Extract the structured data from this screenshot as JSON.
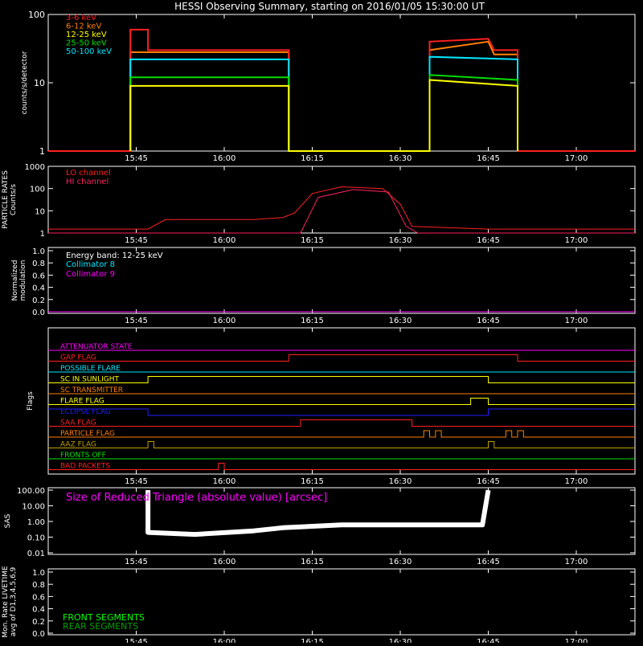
{
  "title": "HESSI Observing Summary, starting on 2016/01/05 15:30:00 UT",
  "time_ticks": [
    "15:45",
    "16:00",
    "16:15",
    "16:30",
    "16:45",
    "17:00"
  ],
  "colors": {
    "background": "#000000",
    "axes": "#ffffff",
    "e3_6": "#ff2020",
    "e6_12": "#ff8000",
    "e12_25": "#ffff00",
    "e25_50": "#00e000",
    "e50_100": "#00e8ff",
    "lo_channel": "#ff2020",
    "hi_channel": "#ff2060",
    "magenta": "#ff00ff",
    "front_segments": "#00ff00",
    "rear_segments": "#00a000"
  },
  "chart_data": [
    {
      "panel": "counts",
      "type": "line",
      "ylabel": "counts/s/detector",
      "yscale": "log",
      "ylim": [
        1,
        100
      ],
      "ytick_labels": [
        "1",
        "10",
        "100"
      ],
      "xlim": [
        "15:30",
        "17:10"
      ],
      "series": [
        {
          "name": "3-6 keV",
          "points": [
            [
              "15:30",
              1
            ],
            [
              "15:44",
              1
            ],
            [
              "15:44",
              60
            ],
            [
              "15:47",
              60
            ],
            [
              "15:47",
              30
            ],
            [
              "16:11",
              30
            ],
            [
              "16:11",
              1
            ],
            [
              "16:35",
              1
            ],
            [
              "16:35",
              40
            ],
            [
              "16:45",
              44
            ],
            [
              "16:46",
              30
            ],
            [
              "16:50",
              30
            ],
            [
              "16:50",
              1
            ],
            [
              "17:10",
              1
            ]
          ]
        },
        {
          "name": "6-12 keV",
          "points": [
            [
              "15:44",
              1
            ],
            [
              "15:44",
              28
            ],
            [
              "16:11",
              28
            ],
            [
              "16:11",
              1
            ],
            [
              "16:35",
              1
            ],
            [
              "16:35",
              30
            ],
            [
              "16:45",
              40
            ],
            [
              "16:46",
              26
            ],
            [
              "16:50",
              26
            ],
            [
              "16:50",
              1
            ]
          ]
        },
        {
          "name": "12-25 keV",
          "points": [
            [
              "15:44",
              1
            ],
            [
              "15:44",
              9
            ],
            [
              "16:11",
              9
            ],
            [
              "16:11",
              1
            ],
            [
              "16:35",
              1
            ],
            [
              "16:35",
              11
            ],
            [
              "16:50",
              9
            ],
            [
              "16:50",
              1
            ]
          ]
        },
        {
          "name": "25-50 keV",
          "points": [
            [
              "15:44",
              1
            ],
            [
              "15:44",
              12
            ],
            [
              "16:11",
              12
            ],
            [
              "16:11",
              1
            ],
            [
              "16:35",
              1
            ],
            [
              "16:35",
              13
            ],
            [
              "16:50",
              11
            ],
            [
              "16:50",
              1
            ]
          ]
        },
        {
          "name": "50-100 keV",
          "points": [
            [
              "15:44",
              1
            ],
            [
              "15:44",
              22
            ],
            [
              "16:11",
              22
            ],
            [
              "16:11",
              1
            ],
            [
              "16:35",
              1
            ],
            [
              "16:35",
              24
            ],
            [
              "16:50",
              22
            ],
            [
              "16:50",
              1
            ]
          ]
        }
      ]
    },
    {
      "panel": "particle",
      "type": "line",
      "ylabel": "PARTICLE RATES\nCounts/s",
      "yscale": "log",
      "ylim": [
        1,
        1000
      ],
      "ytick_labels": [
        "1",
        "10",
        "100",
        "1000"
      ],
      "legend": [
        "LO channel",
        "HI channel"
      ],
      "series": [
        {
          "name": "LO channel",
          "points": [
            [
              "15:30",
              1.5
            ],
            [
              "15:47",
              1.5
            ],
            [
              "15:50",
              4
            ],
            [
              "16:05",
              4
            ],
            [
              "16:10",
              5
            ],
            [
              "16:12",
              8
            ],
            [
              "16:15",
              60
            ],
            [
              "16:20",
              120
            ],
            [
              "16:27",
              100
            ],
            [
              "16:30",
              20
            ],
            [
              "16:32",
              2
            ],
            [
              "16:45",
              1.5
            ],
            [
              "17:10",
              1.5
            ]
          ]
        },
        {
          "name": "HI channel",
          "points": [
            [
              "15:30",
              1
            ],
            [
              "16:13",
              1
            ],
            [
              "16:16",
              40
            ],
            [
              "16:22",
              90
            ],
            [
              "16:28",
              70
            ],
            [
              "16:31",
              2
            ],
            [
              "16:33",
              1
            ],
            [
              "17:10",
              1
            ]
          ]
        }
      ]
    },
    {
      "panel": "modulation",
      "type": "line",
      "ylabel": "Normalized\nmodulation",
      "ylim": [
        0,
        1
      ],
      "ytick_labels": [
        "0.0",
        "0.2",
        "0.4",
        "0.6",
        "0.8",
        "1.0"
      ],
      "annotations": [
        "Energy band: 12-25 keV",
        "Collimator 8",
        "Collimator 9"
      ],
      "series": [
        {
          "name": "Collimator 9",
          "points": [
            [
              "15:30",
              0
            ],
            [
              "17:10",
              0
            ]
          ]
        }
      ]
    },
    {
      "panel": "flags",
      "type": "flags",
      "ylabel": "Flags",
      "rows": [
        {
          "name": "ATTENUATOR STATE",
          "color": "#ff00ff",
          "segments": [
            [
              "15:30",
              "17:10",
              0
            ]
          ]
        },
        {
          "name": "GAP FLAG",
          "color": "#ff2020",
          "segments": [
            [
              "15:30",
              "16:11",
              0
            ],
            [
              "16:11",
              "16:50",
              1
            ],
            [
              "16:50",
              "17:10",
              0
            ]
          ]
        },
        {
          "name": "POSSIBLE FLARE",
          "color": "#00e8ff",
          "segments": [
            [
              "15:30",
              "17:10",
              0
            ]
          ]
        },
        {
          "name": "SC IN SUNLIGHT",
          "color": "#ffff00",
          "segments": [
            [
              "15:30",
              "15:47",
              0
            ],
            [
              "15:47",
              "16:45",
              1
            ],
            [
              "16:45",
              "17:10",
              0
            ]
          ]
        },
        {
          "name": "SC TRANSMITTER",
          "color": "#ff8000",
          "segments": [
            [
              "15:30",
              "17:10",
              0
            ]
          ]
        },
        {
          "name": "FLARE FLAG",
          "color": "#ffff00",
          "segments": [
            [
              "15:30",
              "16:42",
              0
            ],
            [
              "16:42",
              "16:45",
              1
            ],
            [
              "16:45",
              "17:10",
              0
            ]
          ]
        },
        {
          "name": "ECLIPSE FLAG",
          "color": "#2020ff",
          "segments": [
            [
              "15:30",
              "15:47",
              1
            ],
            [
              "15:47",
              "16:45",
              0
            ],
            [
              "16:45",
              "17:10",
              1
            ]
          ]
        },
        {
          "name": "SAA FLAG",
          "color": "#ff2020",
          "segments": [
            [
              "15:30",
              "16:13",
              0
            ],
            [
              "16:13",
              "16:32",
              1
            ],
            [
              "16:32",
              "17:10",
              0
            ]
          ]
        },
        {
          "name": "PARTICLE FLAG",
          "color": "#ff8000",
          "segments": [
            [
              "15:30",
              "16:34",
              0
            ],
            [
              "16:34",
              "16:35",
              1
            ],
            [
              "16:35",
              "16:36",
              0
            ],
            [
              "16:36",
              "16:37",
              1
            ],
            [
              "16:37",
              "16:48",
              0
            ],
            [
              "16:48",
              "16:49",
              1
            ],
            [
              "16:49",
              "16:50",
              0
            ],
            [
              "16:50",
              "16:51",
              1
            ],
            [
              "16:51",
              "17:10",
              0
            ]
          ]
        },
        {
          "name": "AAZ FLAG",
          "color": "#c0a000",
          "segments": [
            [
              "15:30",
              "15:47",
              0
            ],
            [
              "15:47",
              "15:48",
              1
            ],
            [
              "15:48",
              "16:45",
              0
            ],
            [
              "16:45",
              "16:46",
              1
            ],
            [
              "16:46",
              "17:10",
              0
            ]
          ]
        },
        {
          "name": "FRONTS OFF",
          "color": "#00e000",
          "segments": [
            [
              "15:30",
              "17:10",
              0
            ]
          ]
        },
        {
          "name": "BAD PACKETS",
          "color": "#ff2020",
          "segments": [
            [
              "15:30",
              "15:59",
              0
            ],
            [
              "15:59",
              "16:00",
              1
            ],
            [
              "16:00",
              "17:10",
              0
            ]
          ]
        }
      ]
    },
    {
      "panel": "sas",
      "type": "line",
      "ylabel": "SAS",
      "yscale": "log",
      "ylim": [
        0.01,
        100
      ],
      "ytick_labels": [
        "0.01",
        "0.10",
        "1.00",
        "10.00",
        "100.00"
      ],
      "annotation": "Size of Reduced Triangle (absolute value) [arcsec]",
      "series": [
        {
          "name": "SAS",
          "points": [
            [
              "15:47",
              100
            ],
            [
              "15:47",
              0.2
            ],
            [
              "15:55",
              0.15
            ],
            [
              "16:05",
              0.25
            ],
            [
              "16:10",
              0.4
            ],
            [
              "16:20",
              0.6
            ],
            [
              "16:30",
              0.6
            ],
            [
              "16:44",
              0.6
            ],
            [
              "16:45",
              100
            ]
          ]
        }
      ]
    },
    {
      "panel": "livetime",
      "type": "line",
      "ylabel": "Mon. Rate LIVETIME\navg of D1,3,4,5,6,9",
      "ylim": [
        0,
        1
      ],
      "ytick_labels": [
        "0.0",
        "0.2",
        "0.4",
        "0.6",
        "0.8",
        "1.0"
      ],
      "legend": [
        "FRONT SEGMENTS",
        "REAR SEGMENTS"
      ],
      "series": []
    }
  ]
}
